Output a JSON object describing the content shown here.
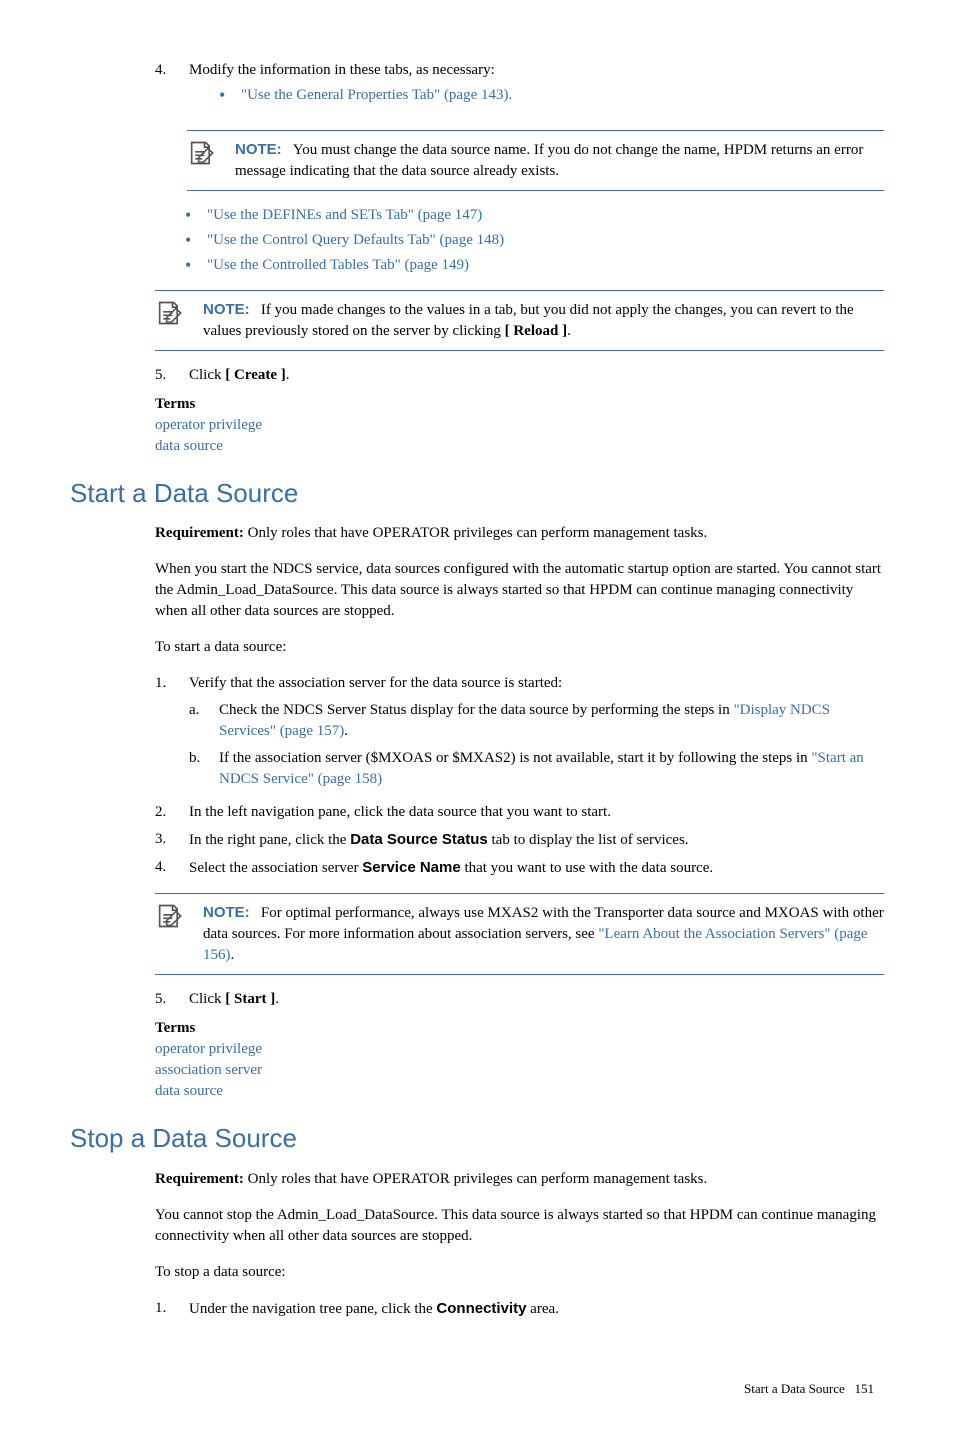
{
  "section_prev": {
    "step4": {
      "num": "4.",
      "text": "Modify the information in these tabs, as necessary:",
      "bullets": [
        "\"Use the General Properties Tab\" (page 143)."
      ]
    },
    "note1": {
      "label": "NOTE:",
      "text": "You must change the data source name. If you do not change the name, HPDM returns an error message indicating that the data source already exists."
    },
    "step4b_bullets": [
      "\"Use the DEFINEs and SETs Tab\" (page 147)",
      "\"Use the Control Query Defaults Tab\" (page 148)",
      "\"Use the Controlled Tables Tab\" (page 149)"
    ],
    "note2": {
      "label": "NOTE:",
      "text_before": "If you made changes to the values in a tab, but you did not apply the changes, you can revert to the values previously stored on the server by clicking ",
      "bold": "[ Reload ]",
      "text_after": "."
    },
    "step5": {
      "num": "5.",
      "text_before": "Click ",
      "bold": "[ Create ]",
      "text_after": "."
    },
    "terms_heading": "Terms",
    "terms": [
      "operator privilege",
      "data source"
    ]
  },
  "section_start": {
    "heading": "Start a Data Source",
    "req_label": "Requirement:",
    "req_text": " Only roles that have OPERATOR privileges can perform management tasks.",
    "para1": "When you start the NDCS service, data sources configured with the automatic startup option are started. You cannot start the Admin_Load_DataSource. This data source is always started so that HPDM can continue managing connectivity when all other data sources are stopped.",
    "para2": "To start a data source:",
    "step1": {
      "num": "1.",
      "text": "Verify that the association server for the data source is started:",
      "a": {
        "num": "a.",
        "before": "Check the NDCS Server Status display for the data source by performing the steps in ",
        "link": "\"Display NDCS Services\" (page 157)",
        "after": "."
      },
      "b": {
        "num": "b.",
        "before": "If the association server ($MXOAS or $MXAS2) is not available, start it by following the steps in ",
        "link": "\"Start an NDCS Service\" (page 158)",
        "after": ""
      }
    },
    "step2": {
      "num": "2.",
      "text": "In the left navigation pane, click the data source that you want to start."
    },
    "step3": {
      "num": "3.",
      "before": "In the right pane, click the ",
      "bold": "Data Source Status",
      "after": " tab to display the list of services."
    },
    "step4": {
      "num": "4.",
      "before": "Select the association server ",
      "bold": "Service Name",
      "after": " that you want to use with the data source."
    },
    "note": {
      "label": "NOTE:",
      "before": "For optimal performance, always use MXAS2 with the Transporter data source and MXOAS with other data sources. For more information about association servers, see ",
      "link": "\"Learn About the Association Servers\" (page 156)",
      "after": "."
    },
    "step5": {
      "num": "5.",
      "text_before": "Click ",
      "bold": "[ Start ]",
      "text_after": "."
    },
    "terms_heading": "Terms",
    "terms": [
      "operator privilege",
      "association server",
      "data source"
    ]
  },
  "section_stop": {
    "heading": "Stop a Data Source",
    "req_label": "Requirement:",
    "req_text": " Only roles that have OPERATOR privileges can perform management tasks.",
    "para1": "You cannot stop the Admin_Load_DataSource. This data source is always started so that HPDM can continue managing connectivity when all other data sources are stopped.",
    "para2": "To stop a data source:",
    "step1": {
      "num": "1.",
      "before": "Under the navigation tree pane, click the ",
      "bold": "Connectivity",
      "after": " area."
    }
  },
  "footer": {
    "title": "Start a Data Source",
    "page": "151"
  }
}
